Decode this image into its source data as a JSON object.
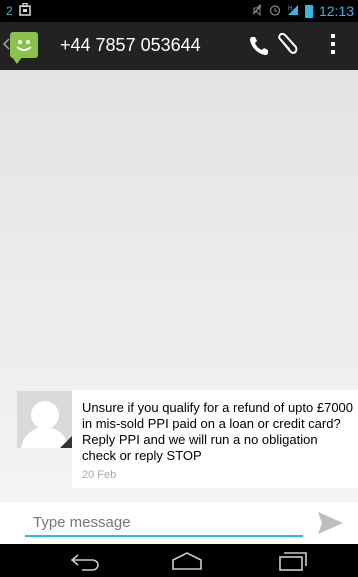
{
  "status_bar": {
    "notification_count": "2",
    "time": "12:13"
  },
  "action_bar": {
    "contact_title": "+44 7857 053644"
  },
  "messages": [
    {
      "text": "Unsure if you qualify for a refund of upto £7000 in mis-sold PPI paid on a loan or credit card? Reply PPI and we will run a no obligation check or reply STOP",
      "date": "20 Feb"
    }
  ],
  "compose": {
    "placeholder": "Type message"
  },
  "colors": {
    "accent": "#33b5e5",
    "contact_badge": "#8bc34a",
    "action_bar": "#222222"
  },
  "icons": [
    "notification-icon",
    "mute-icon",
    "alarm-icon",
    "signal-icon",
    "battery-icon",
    "call-icon",
    "attach-icon",
    "overflow-menu-icon",
    "send-icon",
    "back-nav-icon",
    "home-nav-icon",
    "recents-nav-icon"
  ]
}
